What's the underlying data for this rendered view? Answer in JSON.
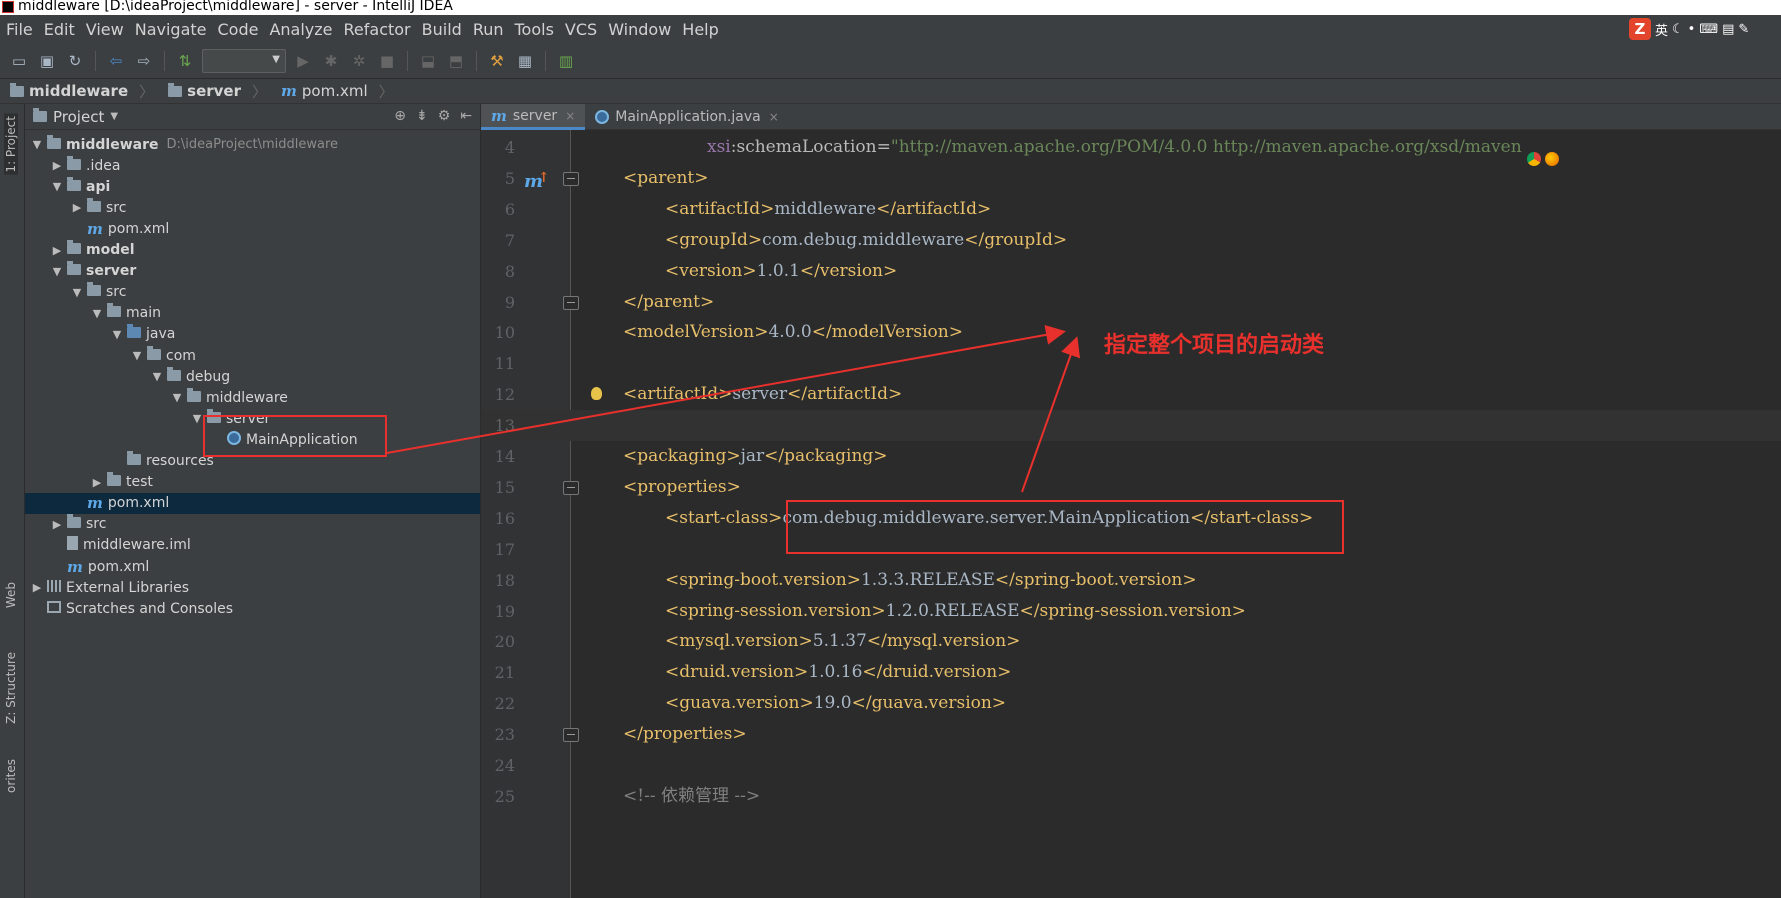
{
  "window": {
    "title": "middleware [D:\\ideaProject\\middleware] - server - IntelliJ IDEA"
  },
  "menu": [
    "File",
    "Edit",
    "View",
    "Navigate",
    "Code",
    "Analyze",
    "Refactor",
    "Build",
    "Run",
    "Tools",
    "VCS",
    "Window",
    "Help"
  ],
  "ime": {
    "logo": "Z",
    "lang": "英"
  },
  "breadcrumb": [
    {
      "label": "middleware",
      "icon": "folder-icon"
    },
    {
      "label": "server",
      "icon": "folder-icon"
    },
    {
      "label": "pom.xml",
      "icon": "maven-icon"
    }
  ],
  "project_panel": {
    "title": "Project",
    "strip_tabs": {
      "project": "1: Project",
      "web": "Web",
      "structure": "Z: Structure",
      "favorites": "orites"
    },
    "tree": [
      {
        "label": "middleware",
        "path": "D:\\ideaProject\\middleware",
        "level": 0,
        "expanded": true,
        "bold": true,
        "icon": "folder"
      },
      {
        "label": ".idea",
        "level": 1,
        "expanded": false,
        "icon": "folder"
      },
      {
        "label": "api",
        "level": 1,
        "expanded": true,
        "bold": true,
        "icon": "folder"
      },
      {
        "label": "src",
        "level": 2,
        "expanded": false,
        "icon": "folder"
      },
      {
        "label": "pom.xml",
        "level": 2,
        "icon": "maven"
      },
      {
        "label": "model",
        "level": 1,
        "expanded": false,
        "bold": true,
        "icon": "folder"
      },
      {
        "label": "server",
        "level": 1,
        "expanded": true,
        "bold": true,
        "icon": "folder"
      },
      {
        "label": "src",
        "level": 2,
        "expanded": true,
        "icon": "folder"
      },
      {
        "label": "main",
        "level": 3,
        "expanded": true,
        "icon": "folder"
      },
      {
        "label": "java",
        "level": 4,
        "expanded": true,
        "icon": "folder-blue"
      },
      {
        "label": "com",
        "level": 5,
        "expanded": true,
        "icon": "package"
      },
      {
        "label": "debug",
        "level": 6,
        "expanded": true,
        "icon": "package"
      },
      {
        "label": "middleware",
        "level": 7,
        "expanded": true,
        "icon": "package"
      },
      {
        "label": "server",
        "level": 8,
        "expanded": true,
        "icon": "package"
      },
      {
        "label": "MainApplication",
        "level": 9,
        "icon": "class"
      },
      {
        "label": "resources",
        "level": 4,
        "icon": "folder"
      },
      {
        "label": "test",
        "level": 3,
        "expanded": false,
        "icon": "folder"
      },
      {
        "label": "pom.xml",
        "level": 2,
        "icon": "maven",
        "selected": true
      },
      {
        "label": "src",
        "level": 1,
        "expanded": false,
        "icon": "folder"
      },
      {
        "label": "middleware.iml",
        "level": 1,
        "icon": "file"
      },
      {
        "label": "pom.xml",
        "level": 1,
        "icon": "maven"
      },
      {
        "label": "External Libraries",
        "level": 0,
        "expanded": false,
        "icon": "library"
      },
      {
        "label": "Scratches and Consoles",
        "level": 0,
        "icon": "scratch"
      }
    ]
  },
  "tabs": [
    {
      "label": "server",
      "icon": "maven-icon",
      "active": true,
      "close": "×"
    },
    {
      "label": "MainApplication.java",
      "icon": "class-icon",
      "active": false,
      "close": "×"
    }
  ],
  "editor": {
    "lines": [
      {
        "n": "4",
        "indent": 2,
        "tokens": [
          [
            "ns",
            "xsi"
          ],
          [
            "attr",
            ":schemaLocation="
          ],
          [
            "val",
            "\"http://maven.apache.org/POM/4.0.0 http://maven.apache.org/xsd/maven"
          ]
        ]
      },
      {
        "n": "5",
        "indent": 0,
        "tokens": [
          [
            "tag",
            "<parent>"
          ]
        ],
        "fold": true,
        "gutter_icon": true
      },
      {
        "n": "6",
        "indent": 1,
        "tokens": [
          [
            "tag",
            "<artifactId>"
          ],
          [
            "txt",
            "middleware"
          ],
          [
            "tag",
            "</artifactId>"
          ]
        ]
      },
      {
        "n": "7",
        "indent": 1,
        "tokens": [
          [
            "tag",
            "<groupId>"
          ],
          [
            "txt",
            "com.debug.middleware"
          ],
          [
            "tag",
            "</groupId>"
          ]
        ]
      },
      {
        "n": "8",
        "indent": 1,
        "tokens": [
          [
            "tag",
            "<version>"
          ],
          [
            "txt",
            "1.0.1"
          ],
          [
            "tag",
            "</version>"
          ]
        ]
      },
      {
        "n": "9",
        "indent": 0,
        "tokens": [
          [
            "tag",
            "</parent>"
          ]
        ],
        "fold": true
      },
      {
        "n": "10",
        "indent": 0,
        "tokens": [
          [
            "tag",
            "<modelVersion>"
          ],
          [
            "txt",
            "4.0.0"
          ],
          [
            "tag",
            "</modelVersion>"
          ]
        ]
      },
      {
        "n": "11",
        "indent": 0,
        "tokens": []
      },
      {
        "n": "12",
        "indent": 0,
        "tokens": [
          [
            "tag",
            "<artifactId>"
          ],
          [
            "txt",
            "server"
          ],
          [
            "tag",
            "</artifactId>"
          ]
        ],
        "bulb": true
      },
      {
        "n": "13",
        "indent": 0,
        "tokens": [],
        "current": true
      },
      {
        "n": "14",
        "indent": 0,
        "tokens": [
          [
            "tag",
            "<packaging>"
          ],
          [
            "txt",
            "jar"
          ],
          [
            "tag",
            "</packaging>"
          ]
        ]
      },
      {
        "n": "15",
        "indent": 0,
        "tokens": [
          [
            "tag",
            "<properties>"
          ]
        ],
        "fold": true
      },
      {
        "n": "16",
        "indent": 1,
        "tokens": [
          [
            "tag",
            "<start-class>"
          ],
          [
            "txt",
            "com.debug.middleware.server.MainApplication"
          ],
          [
            "tag",
            "</start-class>"
          ]
        ]
      },
      {
        "n": "17",
        "indent": 0,
        "tokens": []
      },
      {
        "n": "18",
        "indent": 1,
        "tokens": [
          [
            "tag",
            "<spring-boot.version>"
          ],
          [
            "txt",
            "1.3.3.RELEASE"
          ],
          [
            "tag",
            "</spring-boot.version>"
          ]
        ]
      },
      {
        "n": "19",
        "indent": 1,
        "tokens": [
          [
            "tag",
            "<spring-session.version>"
          ],
          [
            "txt",
            "1.2.0.RELEASE"
          ],
          [
            "tag",
            "</spring-session.version>"
          ]
        ]
      },
      {
        "n": "20",
        "indent": 1,
        "tokens": [
          [
            "tag",
            "<mysql.version>"
          ],
          [
            "txt",
            "5.1.37"
          ],
          [
            "tag",
            "</mysql.version>"
          ]
        ]
      },
      {
        "n": "21",
        "indent": 1,
        "tokens": [
          [
            "tag",
            "<druid.version>"
          ],
          [
            "txt",
            "1.0.16"
          ],
          [
            "tag",
            "</druid.version>"
          ]
        ]
      },
      {
        "n": "22",
        "indent": 1,
        "tokens": [
          [
            "tag",
            "<guava.version>"
          ],
          [
            "txt",
            "19.0"
          ],
          [
            "tag",
            "</guava.version>"
          ]
        ]
      },
      {
        "n": "23",
        "indent": 0,
        "tokens": [
          [
            "tag",
            "</properties>"
          ]
        ],
        "fold": true
      },
      {
        "n": "24",
        "indent": 0,
        "tokens": []
      },
      {
        "n": "25",
        "indent": 0,
        "tokens": [
          [
            "cmt",
            "<!-- 依赖管理 -->"
          ]
        ]
      }
    ]
  },
  "annotation": {
    "text": "指定整个项目的启动类",
    "color": "#e8302c"
  }
}
